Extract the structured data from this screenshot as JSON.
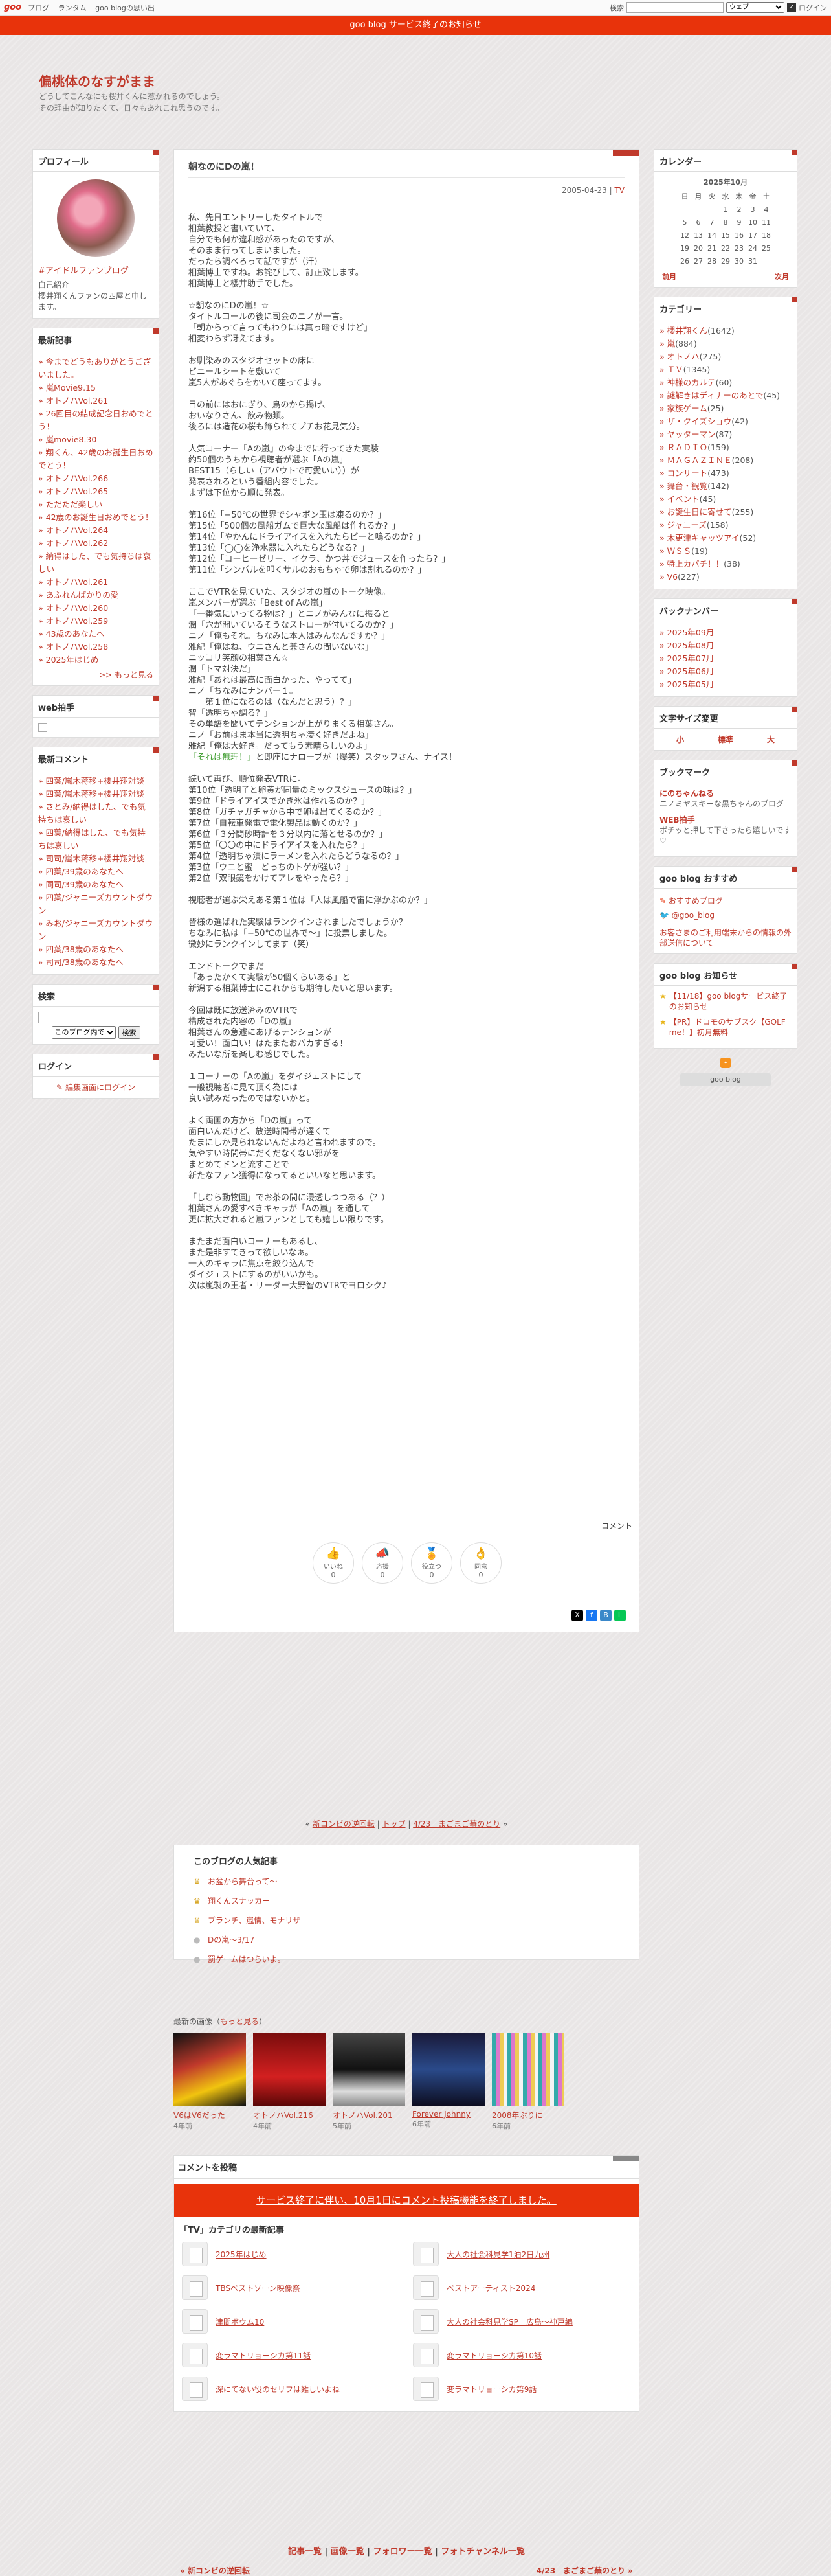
{
  "topbar": {
    "logo": "goo",
    "nav": [
      "ブログ",
      "ランタム",
      "goo blogの思い出"
    ],
    "search_label": "検索",
    "search_scope": "ウェブ",
    "login": "ログイン"
  },
  "notice": "goo blog サービス終了のお知らせ",
  "blog": {
    "title": "偏桃体のなすがまま",
    "desc1": "どうしてこんなにも桜井くんに惹かれるのでしょう。",
    "desc2": "その理由が知りたくて、日々もあれこれ思うのです。"
  },
  "profile": {
    "header": "プロフィール",
    "link": "#アイドルファンブログ",
    "intro_label": "自己紹介",
    "intro": "櫻井翔くんファンの四屋と申します。"
  },
  "recent": {
    "header": "最新記事",
    "items": [
      "今までどうもありがとうございました。",
      "嵐Movie9.15",
      "オトノハVol.261",
      "26回目の結成記念日おめでとう！",
      "嵐movie8.30",
      "翔くん、42歳のお誕生日おめでとう！",
      "オトノハVol.266",
      "オトノハVol.265",
      "ただただ楽しい",
      "42歳のお誕生日おめでとう！",
      "オトノハVol.264",
      "オトノハVol.262",
      "納得はした、でも気持ちは哀しい",
      "オトノハVol.261",
      "あふれんばかりの愛",
      "オトノハVol.260",
      "オトノハVol.259",
      "43歳のあなたへ",
      "オトノハVol.258",
      "2025年はじめ"
    ],
    "more": ">> もっと見る"
  },
  "webclap": {
    "header": "web拍手"
  },
  "comments": {
    "header": "最新コメント",
    "items": [
      "四葉/嵐木蒋移+櫻井翔対談",
      "四葉/嵐木蒋移+櫻井翔対談",
      "さとみ/納得はした、でも気持ちは哀しい",
      "四葉/納得はした、でも気持ちは哀しい",
      "司司/嵐木蒋移+櫻井翔対談",
      "四葉/39歳のあなたへ",
      "同司/39歳のあなたへ",
      "四葉/ジャニーズカウントダウン",
      "みお/ジャニーズカウントダウン",
      "四葉/38歳のあなたへ",
      "司司/38歳のあなたへ"
    ]
  },
  "search": {
    "header": "検索",
    "scope": "このブログ内で",
    "button": "検索"
  },
  "login": {
    "header": "ログイン",
    "link": "編集画面にログイン"
  },
  "article": {
    "title": "朝なのにDの嵐！",
    "date": "2005-04-23",
    "category": "TV",
    "paragraphs": [
      [
        "私、先日エントリーしたタイトルで",
        "相葉教授と書いていて、",
        "自分でも何か違和感があったのですが、",
        "そのまま行ってしまいました。",
        "だったら調べろって話ですが（汗）",
        "相葉博士ですね。お詫びして、訂正致します。",
        "相葉博士と櫻井助手でした。"
      ],
      [
        "☆朝なのにDの嵐！☆",
        "タイトルコールの後に司会のニノが一言。",
        "「朝からって言ってもわりには真っ暗ですけど」",
        "相変わらず冴えてます。"
      ],
      [
        "お馴染みのスタジオセットの床に",
        "ビニールシートを敷いて",
        "嵐5人があぐらをかいて座ってます。"
      ],
      [
        "目の前にはおにぎり、鳥のから揚げ、",
        "おいなりさん、飲み物類。",
        "後ろには造花の桜も飾られてプチお花見気分。"
      ],
      [
        "人気コーナー「Aの嵐」の今までに行ってきた実験",
        "約50個のうちから視聴者が選ぶ「Aの嵐」",
        "BEST15（らしい（アバウトで可愛いい））が",
        "発表されるという番組内容でした。",
        "まずは下位から順に発表。"
      ],
      [
        "第16位「−50℃の世界でシャボン玉は凍るのか？」",
        "第15位「500個の風船ガムで巨大な風船は作れるか？」",
        "第14位「やかんにドライアイスを入れたらピーと鳴るのか？」",
        "第13位「◯◯を浄水器に入れたらどうなる？」",
        "第12位「コーヒーゼリー、イクラ、かつ丼でジュースを作ったら？」",
        "第11位「シンバルを叩くサルのおもちゃで卵は割れるのか？」"
      ],
      [
        "ここでVTRを見ていた、スタジオの嵐のトーク映像。",
        "嵐メンバーが選ぶ「Best of Aの嵐」",
        "「一番気にいってる物は？」とニノがみんなに振ると",
        "潤「穴が開いているそうなストローが付いてるのか？」",
        "ニノ「俺もそれ。ちなみに本人はみんなんですか？」",
        "雅紀「俺はね、ウニさんと兼さんの間いないな」",
        "ニッコリ笑顔の相葉さん☆",
        "潤「トマ対決だ」",
        "雅紀「あれは最高に面白かった、やってて」",
        "ニノ「ちなみにナンバー１。",
        "　　第１位になるのは（なんだと思う）？」",
        "智「透明ちゃ調る？」",
        "その単語を聞いてテンションが上がりまくる相葉さん。",
        "ニノ「お前はま本当に透明ちゃ凄く好きだよね」",
        "雅紀「俺は大好き。だってもう素晴らしいのよ」"
      ],
      [
        "続いて再び、順位発表VTRに。",
        "第10位「透明子と卵黄が同量のミックスジュースの味は？」",
        "第9位「ドライアイスでかき氷は作れるのか？」",
        "第8位「ガチャガチャから中で卵は出てくるのか？」",
        "第7位「自転車発電で電化製品は動くのか？」",
        "第6位「３分間砂時計を３分以内に落とせるのか？」",
        "第5位「〇〇の中にドライアイスを入れたら？」",
        "第4位「透明ちゃ漬にラーメンを入れたらどうなるの？」",
        "第3位「ウニと蜜　どっちのトゲが強い？」",
        "第2位「双眼鏡をかけてアレをやったら？」"
      ],
      [
        "視聴者が選ぶ栄えある第１位は「人は風船で宙に浮かぶのか？」"
      ],
      [
        "皆様の選ばれた実験はランクインされましたでしょうか？",
        "ちなみに私は「−50℃の世界で〜」に投票しました。",
        "微妙にランクインしてます（笑）"
      ],
      [
        "エンドトークでまだ",
        "「あったかくて実験が50個くらいある」と",
        "新潟する相葉博士にこれからも期待したいと思います。"
      ],
      [
        "今回は既に放送済みのVTRで",
        "構成された内容の「Dの嵐」",
        "相葉さんの急遽にあげるテンションが",
        "可愛い！面白い！はたまたおバカすぎる！",
        "みたいな所を楽しむ感じでした。"
      ],
      [
        "１コーナーの「Aの嵐」をダイジェストにして",
        "一般視聴者に見て頂く為には",
        "良い試みだったのではないかと。"
      ],
      [
        "よく両国の方から「Dの嵐」って",
        "面白いんだけど、放送時間帯が遅くて",
        "たまにしか見られないんだよねと言われますので。",
        "気やすい時間帯にだくだなくない邪がを",
        "まとめてドンと流すことで",
        "新たなファン獲得になってるといいなと思います。"
      ],
      [
        "「しむら動物園」でお茶の間に浸透しつつある（？）",
        "相葉さんの愛すべきキャラが「Aの嵐」を通して",
        "更に拡大されると嵐ファンとしても嬉しい限りです。"
      ],
      [
        "またまだ面白いコーナーもあるし、",
        "また是非すてきって欲しいなぁ。",
        "一人のキャラに焦点を絞り込んで",
        "ダイジェストにするのがいいかも。",
        "次は嵐製の王者・リーダー大野智のVTRでヨロシク♪"
      ]
    ],
    "green_line": "「それは無理！」",
    "green_rest": "と即座にナローブが（爆笑）スタッフさん、ナイス！",
    "comment_link": "コメント",
    "reactions": [
      {
        "label": "いいね",
        "icon": "👍",
        "count": "0"
      },
      {
        "label": "応援",
        "icon": "📣",
        "count": "0"
      },
      {
        "label": "役立つ",
        "icon": "🏅",
        "count": "0"
      },
      {
        "label": "同意",
        "icon": "👌",
        "count": "0"
      }
    ]
  },
  "pager": {
    "prev": "新コンビの逆回転",
    "top": "トップ",
    "next": "4/23　まごまご蕪のとり"
  },
  "popular": {
    "header": "このブログの人気記事",
    "items": [
      "お盆から舞台って〜",
      "翔くんスナッカー",
      "ブランチ、嵐情、モナリザ",
      "Dの嵐〜3/17",
      "罰ゲームはつらいよ。"
    ]
  },
  "images": {
    "header": "最新の画像",
    "more": "もっと見る",
    "items": [
      {
        "caption": "V6はV6だった",
        "ago": "4年前"
      },
      {
        "caption": "オトノハVol.216",
        "ago": "4年前"
      },
      {
        "caption": "オトノハVol.201",
        "ago": "5年前"
      },
      {
        "caption": "Forever Johnny",
        "ago": "6年前"
      },
      {
        "caption": "2008年ぶりに",
        "ago": "6年前"
      }
    ]
  },
  "commentform": {
    "header": "コメントを投稿",
    "closed": "サービス終了に伴い、10月1日にコメント投稿機能を終了しました。",
    "cat_header": "「TV」カテゴリの最新記事",
    "cat_items": [
      "2025年はじめ",
      "大人の社会科見学1泊2日九州",
      "TBSベストソーン映像祭",
      "ベストアーティスト2024",
      "津間ボウム10",
      "大人の社会科見学SP　広島〜神戸編",
      "変ラマトリョーシカ第11話",
      "変ラマトリョーシカ第10話",
      "深にてない役のセリフは難しいよね",
      "変ラマトリョーシカ第9話"
    ]
  },
  "footer": {
    "links": [
      "記事一覧",
      "画像一覧",
      "フォロワー一覧",
      "フォトチャンネル一覧"
    ],
    "prev": "« 新コンビの逆回転",
    "next": "4/23　まごまご蕪のとり »"
  },
  "calendar": {
    "header": "カレンダー",
    "month": "2025年10月",
    "dow": [
      "日",
      "月",
      "火",
      "水",
      "木",
      "金",
      "土"
    ],
    "weeks": [
      [
        "",
        "",
        "",
        "1",
        "2",
        "3",
        "4"
      ],
      [
        "5",
        "6",
        "7",
        "8",
        "9",
        "10",
        "11"
      ],
      [
        "12",
        "13",
        "14",
        "15",
        "16",
        "17",
        "18"
      ],
      [
        "19",
        "20",
        "21",
        "22",
        "23",
        "24",
        "25"
      ],
      [
        "26",
        "27",
        "28",
        "29",
        "30",
        "31",
        ""
      ]
    ],
    "prev": "前月",
    "next": "次月"
  },
  "categories": {
    "header": "カテゴリー",
    "items": [
      {
        "name": "櫻井翔くん",
        "count": "(1642)"
      },
      {
        "name": "嵐",
        "count": "(884)"
      },
      {
        "name": "オトノハ",
        "count": "(275)"
      },
      {
        "name": "ＴＶ",
        "count": "(1345)"
      },
      {
        "name": "神様のカルテ",
        "count": "(60)"
      },
      {
        "name": "謎解きはディナーのあとで",
        "count": "(45)"
      },
      {
        "name": "家族ゲーム",
        "count": "(25)"
      },
      {
        "name": "ザ・クイズショウ",
        "count": "(42)"
      },
      {
        "name": "ヤッターマン",
        "count": "(87)"
      },
      {
        "name": "ＲＡＤＩＯ",
        "count": "(159)"
      },
      {
        "name": "ＭＡＧＡＺＩＮＥ",
        "count": "(208)"
      },
      {
        "name": "コンサート",
        "count": "(473)"
      },
      {
        "name": "舞台・観覧",
        "count": "(142)"
      },
      {
        "name": "イベント",
        "count": "(45)"
      },
      {
        "name": "お誕生日に寄せて",
        "count": "(255)"
      },
      {
        "name": "ジャニーズ",
        "count": "(158)"
      },
      {
        "name": "木更津キャッツアイ",
        "count": "(52)"
      },
      {
        "name": "ＷＳＳ",
        "count": "(19)"
      },
      {
        "name": "特上カバチ！！",
        "count": "(38)"
      },
      {
        "name": "V6",
        "count": "(227)"
      }
    ]
  },
  "backnumber": {
    "header": "バックナンバー",
    "items": [
      "2025年09月",
      "2025年08月",
      "2025年07月",
      "2025年06月",
      "2025年05月"
    ]
  },
  "fontsize": {
    "header": "文字サイズ変更",
    "small": "小",
    "normal": "標準",
    "large": "大"
  },
  "bookmark": {
    "header": "ブックマーク",
    "items": [
      {
        "name": "にのちゃんねる",
        "text": "ニノミヤスキーな黒ちゃんのブログ"
      },
      {
        "name": "WEB拍手",
        "text": "ポチッと押して下さったら嬉しいです♡"
      }
    ]
  },
  "gooinfo": {
    "header": "goo blog おすすめ",
    "items": [
      "おすすめブログ",
      "@goo_blog"
    ],
    "text": "お客さまのご利用端末からの情報の外部送信について"
  },
  "goonews": {
    "header": "goo blog お知らせ",
    "items": [
      "【11/18】goo blogサービス終了のお知らせ",
      "【PR】ドコモのサブスク【GOLF me！】初月無料"
    ],
    "footer_logo": "goo blog"
  }
}
